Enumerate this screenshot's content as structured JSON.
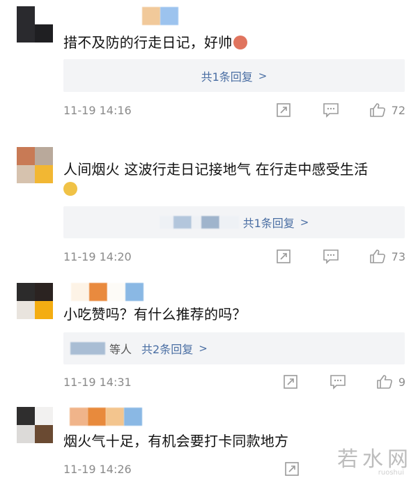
{
  "comments": [
    {
      "text": "措不及防的行走日记，好帅",
      "reply": {
        "label": "共1条回复",
        "chevron": ">"
      },
      "time": "11-19 14:16",
      "likes": "72"
    },
    {
      "text": "人间烟火 这波行走日记接地气 在行走中感受生活",
      "reply": {
        "label": "共1条回复",
        "chevron": ">"
      },
      "time": "11-19 14:20",
      "likes": "73"
    },
    {
      "text": "小吃赞吗？有什么推荐的吗？",
      "reply": {
        "people_suffix": "等人",
        "label": "共2条回复",
        "chevron": ">"
      },
      "time": "11-19 14:31",
      "likes": "9"
    },
    {
      "text": "烟火气十足，有机会要打卡同款地方",
      "time": "11-19 14:26"
    }
  ],
  "colors": {
    "link_blue": "#4a6ea3",
    "meta_gray": "#8a8a8a",
    "reply_bg": "#f3f4f6"
  },
  "icons": [
    "share-icon",
    "comment-icon",
    "like-icon"
  ],
  "watermark": {
    "text": "若水网",
    "sub": "ruoshui"
  }
}
